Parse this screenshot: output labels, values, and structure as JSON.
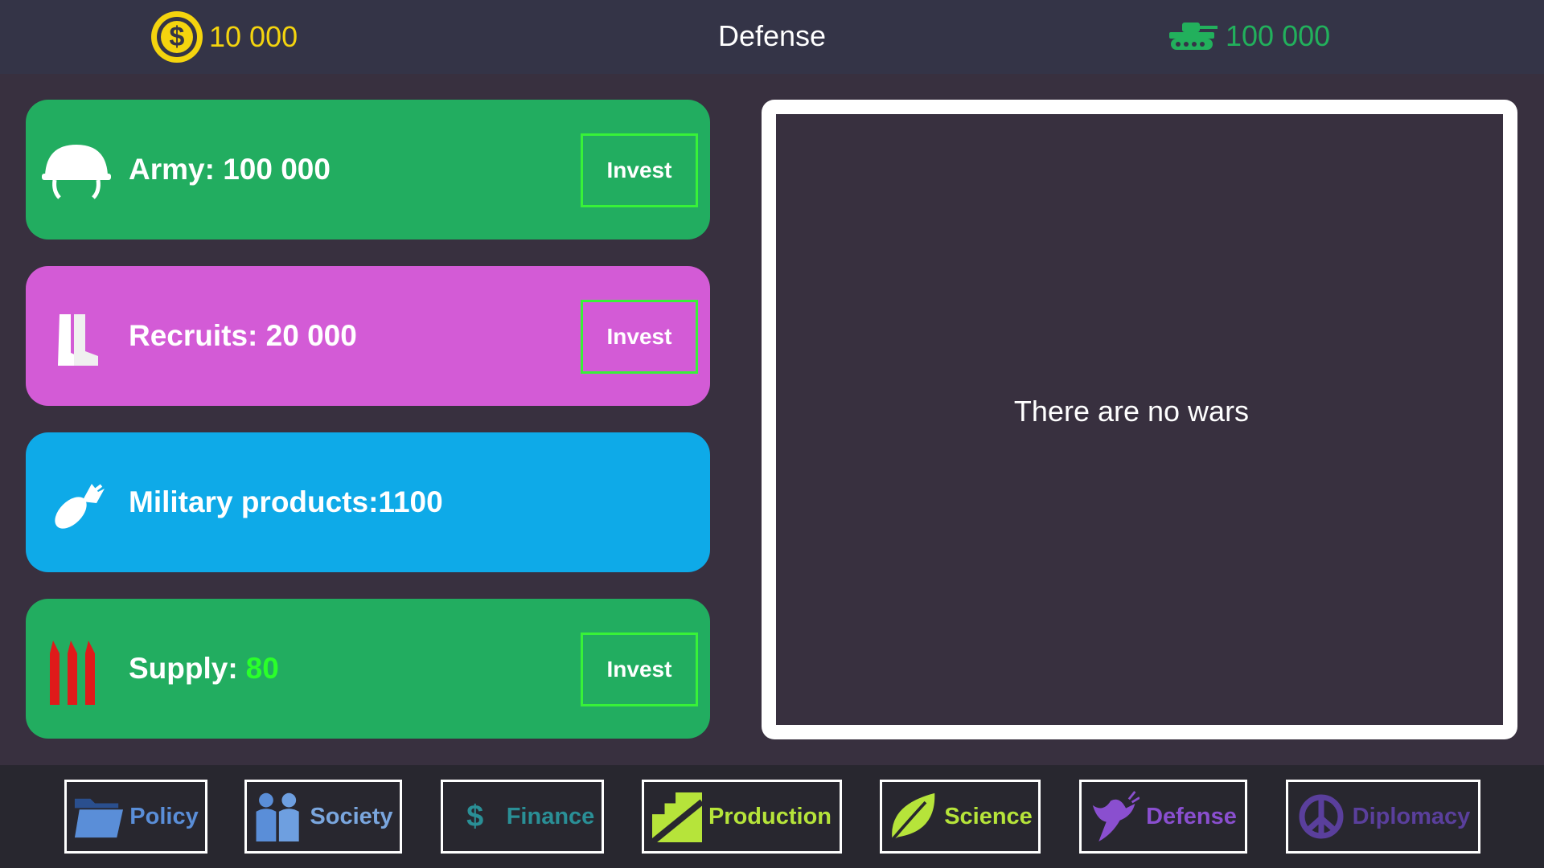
{
  "header": {
    "money": "10 000",
    "title": "Defense",
    "troops": "100 000"
  },
  "cards": {
    "army": {
      "label": "Army: 100 000",
      "button": "Invest"
    },
    "recruits": {
      "label": "Recruits: 20 000",
      "button": "Invest"
    },
    "military": {
      "label": "Military products:1100"
    },
    "supply": {
      "label": "Supply:",
      "value": "80",
      "button": "Invest"
    }
  },
  "wars_panel": {
    "message": "There are no wars"
  },
  "nav": {
    "policy": "Policy",
    "society": "Society",
    "finance": "Finance",
    "production": "Production",
    "science": "Science",
    "defense": "Defense",
    "diplomacy": "Diplomacy"
  },
  "colors": {
    "background": "#38303f",
    "topbar": "#343447",
    "gold": "#f4d40e",
    "green": "#22ad60",
    "magenta": "#d35bd6",
    "blue": "#0eaae8",
    "invest_border": "#38f238"
  },
  "icons": {
    "money": "coin-icon",
    "troops": "tank-icon",
    "army": "helmet-icon",
    "recruits": "boots-icon",
    "military": "bomb-icon",
    "supply": "ammo-icon"
  }
}
